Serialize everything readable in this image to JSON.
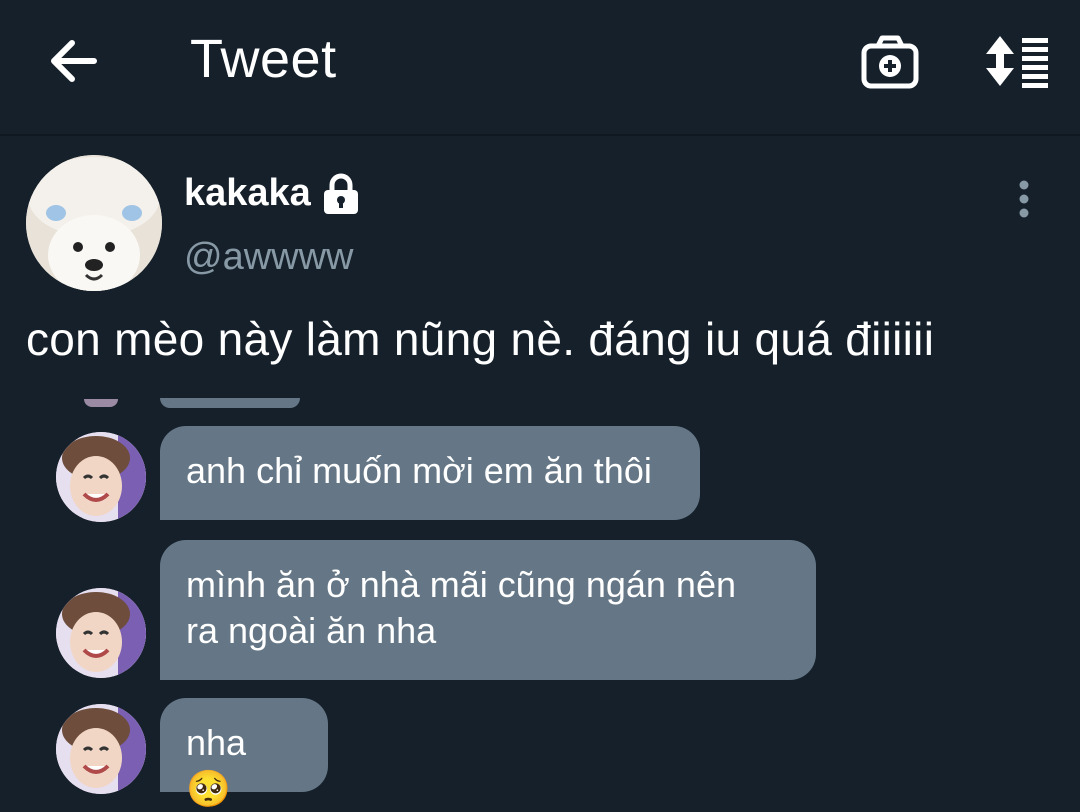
{
  "header": {
    "title": "Tweet",
    "icons": {
      "back": "arrow-left-icon",
      "camera": "camera-plus-icon",
      "sort": "sort-list-icon"
    }
  },
  "tweet": {
    "display_name": "kakaka",
    "handle": "@awwww",
    "text": "con mèo này làm nũng nè. đáng iu quá điiiiii",
    "icons": {
      "locked": "lock-icon",
      "more": "more-vertical-icon"
    }
  },
  "chat": {
    "messages": [
      {
        "text": "anh chỉ muốn mời em ăn thôi"
      },
      {
        "line1": "mình ăn ở nhà mãi cũng ngán nên",
        "line2": "ra ngoài ăn nha"
      },
      {
        "text": "nha",
        "emoji": "🥺"
      }
    ]
  },
  "colors": {
    "background": "#15202b",
    "bubble": "#657786",
    "secondary_text": "#8899a6",
    "primary_text": "#ffffff"
  }
}
